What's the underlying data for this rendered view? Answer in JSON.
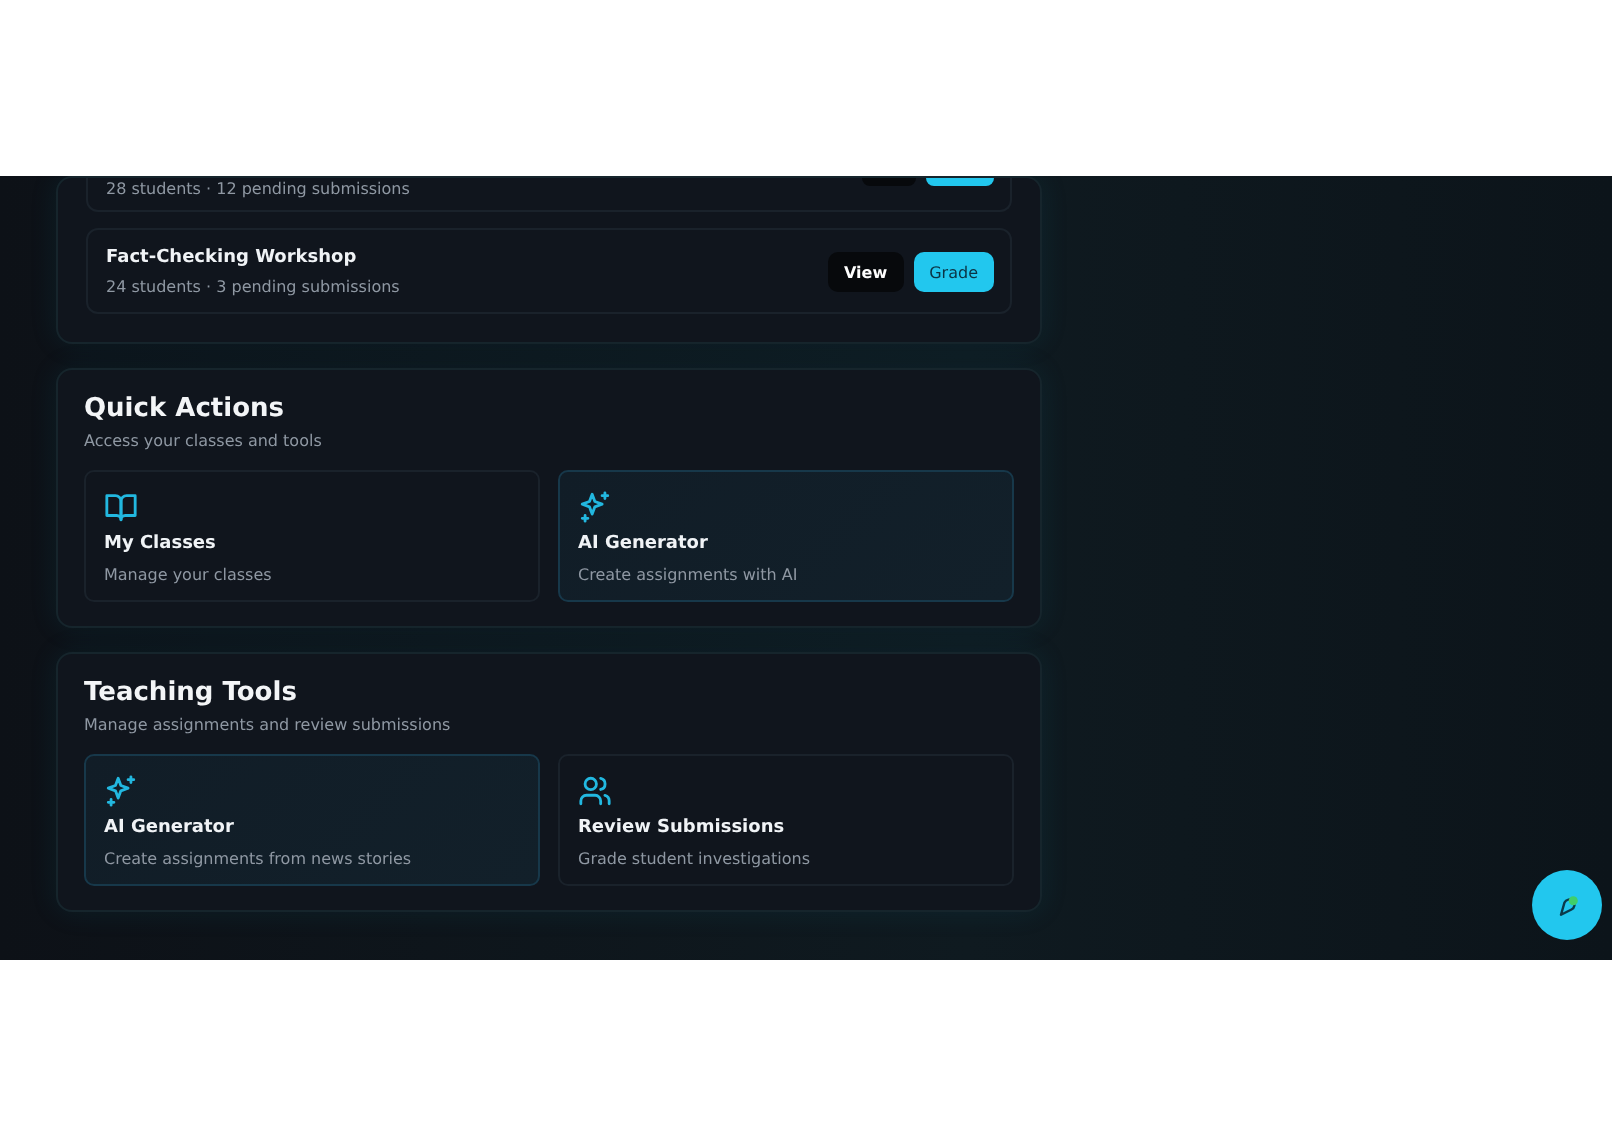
{
  "classes": [
    {
      "meta": "28 students · 12 pending submissions",
      "cut": true
    },
    {
      "title": "Fact-Checking Workshop",
      "meta": "24 students · 3 pending submissions",
      "cut": false,
      "view": "View",
      "grade": "Grade"
    }
  ],
  "sections": [
    {
      "title": "Quick Actions",
      "subtitle": "Access your classes and tools",
      "cards": [
        {
          "kind": "book",
          "title": "My Classes",
          "desc": "Manage your classes",
          "highlighted": false
        },
        {
          "kind": "sparkles",
          "title": "AI Generator",
          "desc": "Create assignments with AI",
          "highlighted": true
        }
      ]
    },
    {
      "title": "Teaching Tools",
      "subtitle": "Manage assignments and review submissions",
      "cards": [
        {
          "kind": "sparkles",
          "title": "AI Generator",
          "desc": "Create assignments from news stories",
          "highlighted": true
        },
        {
          "kind": "users",
          "title": "Review Submissions",
          "desc": "Grade student investigations",
          "highlighted": false
        }
      ]
    }
  ]
}
